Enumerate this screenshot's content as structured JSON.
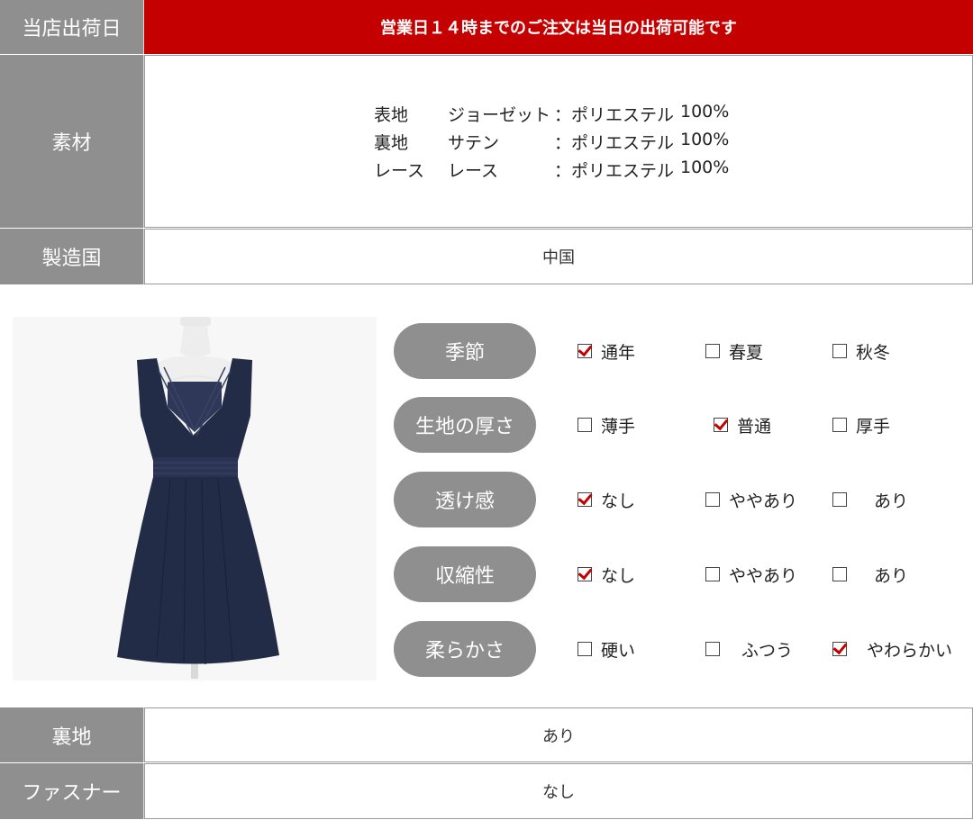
{
  "shipping": {
    "label": "当店出荷日",
    "value": "営業日１４時までのご注文は当日の出荷可能です"
  },
  "material": {
    "label": "素材",
    "items": [
      {
        "part": "表地",
        "fabric": "ジョーゼット",
        "composition": "：ポリエステル",
        "percent": "100%"
      },
      {
        "part": "裏地",
        "fabric": "サテン",
        "composition": "：ポリエステル",
        "percent": "100%"
      },
      {
        "part": "レース",
        "fabric": "レース",
        "composition": "：ポリエステル",
        "percent": "100%"
      }
    ]
  },
  "origin": {
    "label": "製造国",
    "value": "中国"
  },
  "attributes": [
    {
      "name": "季節",
      "options": [
        {
          "label": "通年",
          "checked": true
        },
        {
          "label": "春夏",
          "checked": false
        },
        {
          "label": "秋冬",
          "checked": false
        }
      ]
    },
    {
      "name": "生地の厚さ",
      "options": [
        {
          "label": "薄手",
          "checked": false
        },
        {
          "label": "普通",
          "checked": true
        },
        {
          "label": "厚手",
          "checked": false
        }
      ]
    },
    {
      "name": "透け感",
      "options": [
        {
          "label": "なし",
          "checked": true
        },
        {
          "label": "ややあり",
          "checked": false
        },
        {
          "label": "あり",
          "checked": false
        }
      ]
    },
    {
      "name": "収縮性",
      "options": [
        {
          "label": "なし",
          "checked": true
        },
        {
          "label": "ややあり",
          "checked": false
        },
        {
          "label": "あり",
          "checked": false
        }
      ]
    },
    {
      "name": "柔らかさ",
      "options": [
        {
          "label": "硬い",
          "checked": false
        },
        {
          "label": "ふつう",
          "checked": false
        },
        {
          "label": "やわらかい",
          "checked": true
        }
      ]
    }
  ],
  "lining": {
    "label": "裏地",
    "value": "あり"
  },
  "zipper": {
    "label": "ファスナー",
    "value": "なし"
  },
  "colors": {
    "accent_red": "#c40000",
    "label_gray": "#8f8f8f",
    "dress_navy": "#232c47"
  }
}
